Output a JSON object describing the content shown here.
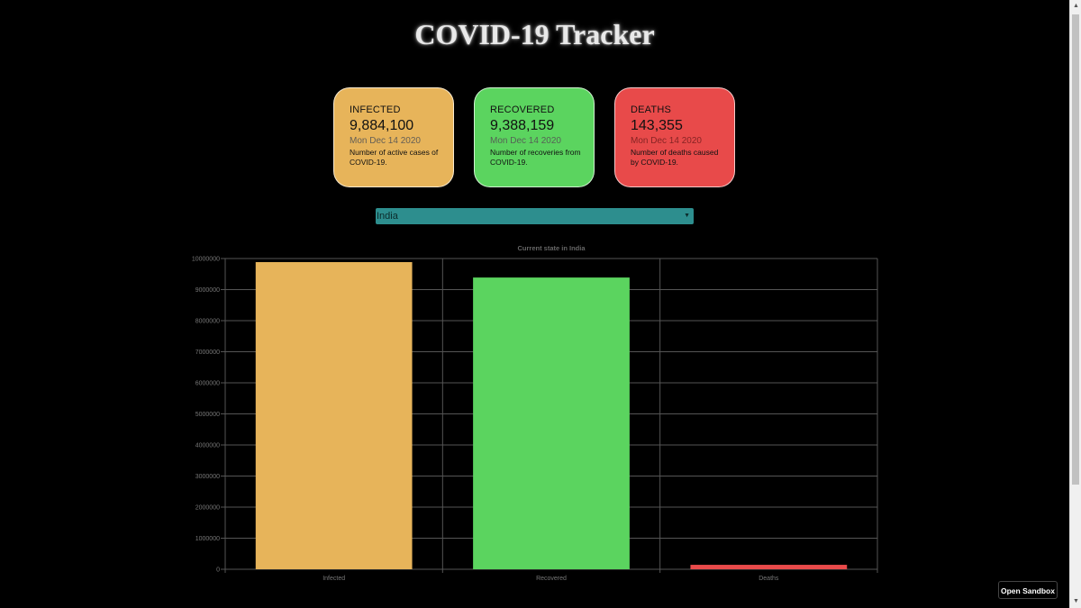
{
  "header": {
    "title": "COVID-19 Tracker"
  },
  "cards": {
    "infected": {
      "label": "INFECTED",
      "value": "9,884,100",
      "date": "Mon Dec 14 2020",
      "description": "Number of active cases of COVID-19.",
      "color": "#e7b45a"
    },
    "recovered": {
      "label": "RECOVERED",
      "value": "9,388,159",
      "date": "Mon Dec 14 2020",
      "description": "Number of recoveries from COVID-19.",
      "color": "#5bd45f"
    },
    "deaths": {
      "label": "DEATHS",
      "value": "143,355",
      "date": "Mon Dec 14 2020",
      "description": "Number of deaths caused by COVID-19.",
      "color": "#e84a4a"
    }
  },
  "country_select": {
    "selected": "India",
    "icon": "caret-down-icon"
  },
  "chart_data": {
    "type": "bar",
    "title": "Current state in India",
    "categories": [
      "Infected",
      "Recovered",
      "Deaths"
    ],
    "values": [
      9884100,
      9388159,
      143355
    ],
    "colors": [
      "#e7b45a",
      "#5bd45f",
      "#e84a4a"
    ],
    "ylim": [
      0,
      10000000
    ],
    "yticks": [
      "0",
      "1000000",
      "2000000",
      "3000000",
      "4000000",
      "5000000",
      "6000000",
      "7000000",
      "8000000",
      "9000000",
      "10000000"
    ],
    "grid": true,
    "legend": "none"
  },
  "sandbox": {
    "label": "Open Sandbox"
  }
}
